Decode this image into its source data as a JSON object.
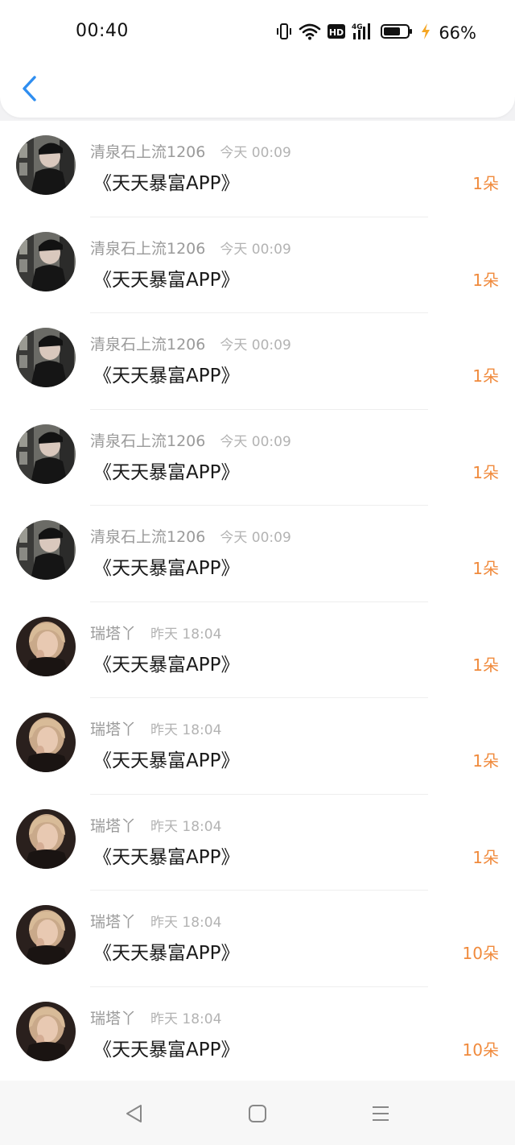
{
  "status_bar": {
    "time": "00:40",
    "battery_percent": "66%",
    "network": "4G"
  },
  "header": {
    "back_icon": "chevron-left-icon",
    "accent": "#2f8ef0"
  },
  "gifts": [
    {
      "name": "清泉石上流1206",
      "time": "今天 00:09",
      "message": "《天天暴富APP》",
      "count": "1朵",
      "avatar": "avatar-a"
    },
    {
      "name": "清泉石上流1206",
      "time": "今天 00:09",
      "message": "《天天暴富APP》",
      "count": "1朵",
      "avatar": "avatar-a"
    },
    {
      "name": "清泉石上流1206",
      "time": "今天 00:09",
      "message": "《天天暴富APP》",
      "count": "1朵",
      "avatar": "avatar-a"
    },
    {
      "name": "清泉石上流1206",
      "time": "今天 00:09",
      "message": "《天天暴富APP》",
      "count": "1朵",
      "avatar": "avatar-a"
    },
    {
      "name": "清泉石上流1206",
      "time": "今天 00:09",
      "message": "《天天暴富APP》",
      "count": "1朵",
      "avatar": "avatar-a"
    },
    {
      "name": "瑞塔丫",
      "time": "昨天 18:04",
      "message": "《天天暴富APP》",
      "count": "1朵",
      "avatar": "avatar-b"
    },
    {
      "name": "瑞塔丫",
      "time": "昨天 18:04",
      "message": "《天天暴富APP》",
      "count": "1朵",
      "avatar": "avatar-b"
    },
    {
      "name": "瑞塔丫",
      "time": "昨天 18:04",
      "message": "《天天暴富APP》",
      "count": "1朵",
      "avatar": "avatar-b"
    },
    {
      "name": "瑞塔丫",
      "time": "昨天 18:04",
      "message": "《天天暴富APP》",
      "count": "10朵",
      "avatar": "avatar-b"
    },
    {
      "name": "瑞塔丫",
      "time": "昨天 18:04",
      "message": "《天天暴富APP》",
      "count": "10朵",
      "avatar": "avatar-b"
    }
  ],
  "colors": {
    "count": "#f08a3c",
    "name": "#9a9a9a",
    "time": "#b3b3b3"
  },
  "navbar": {
    "back": "triangle-back-icon",
    "home": "square-home-icon",
    "menu": "menu-lines-icon"
  }
}
